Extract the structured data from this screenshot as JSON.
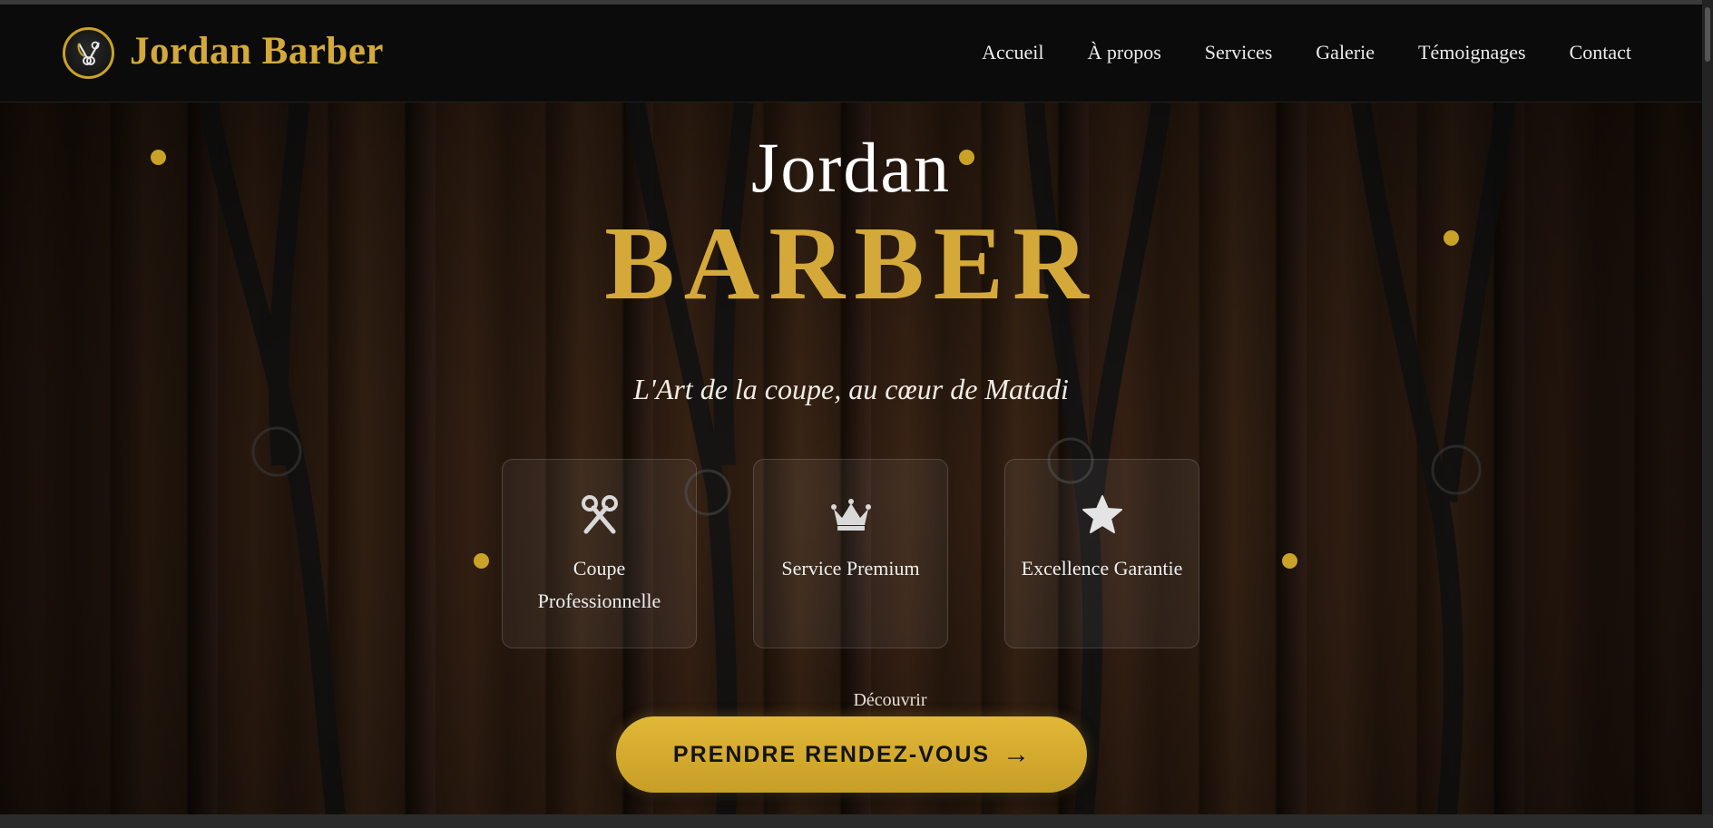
{
  "brand": {
    "name": "Jordan Barber",
    "logo_icon": "scissors-emblem-icon"
  },
  "nav": {
    "items": [
      {
        "label": "Accueil"
      },
      {
        "label": "À propos"
      },
      {
        "label": "Services"
      },
      {
        "label": "Galerie"
      },
      {
        "label": "Témoignages"
      },
      {
        "label": "Contact"
      }
    ]
  },
  "hero": {
    "title_top": "Jordan",
    "title_main": "BARBER",
    "tagline": "L'Art de la coupe, au cœur de Matadi",
    "features": [
      {
        "label": "Coupe Professionnelle",
        "icon": "scissors-icon"
      },
      {
        "label": "Service Premium",
        "icon": "crown-icon"
      },
      {
        "label": "Excellence Garantie",
        "icon": "star-icon"
      }
    ],
    "discover": "Découvrir",
    "cta": {
      "label": "PRENDRE RENDEZ-VOUS",
      "arrow": "→"
    }
  },
  "colors": {
    "accent": "#d4a93a",
    "header_bg": "#0b0b0b",
    "text_light": "#ececec"
  }
}
